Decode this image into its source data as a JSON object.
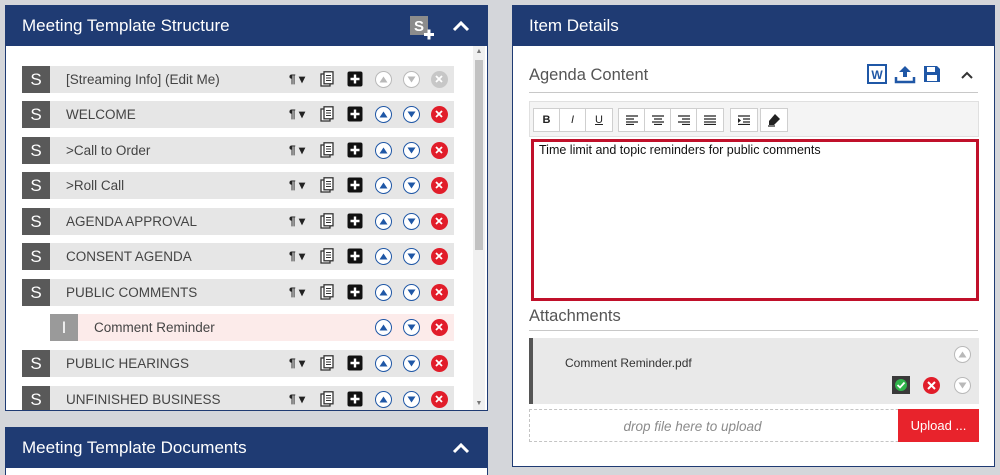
{
  "structure": {
    "title": "Meeting Template Structure",
    "rows": [
      {
        "badge": "S",
        "label": "[Streaming Info] (Edit Me)",
        "kind": "section",
        "first": true
      },
      {
        "badge": "S",
        "label": "WELCOME",
        "kind": "section"
      },
      {
        "badge": "S",
        "label": ">Call to Order",
        "kind": "section"
      },
      {
        "badge": "S",
        "label": ">Roll Call",
        "kind": "section"
      },
      {
        "badge": "S",
        "label": "AGENDA APPROVAL",
        "kind": "section"
      },
      {
        "badge": "S",
        "label": "CONSENT AGENDA",
        "kind": "section"
      },
      {
        "badge": "S",
        "label": "PUBLIC COMMENTS",
        "kind": "section"
      },
      {
        "badge": "I",
        "label": "Comment Reminder",
        "kind": "item"
      },
      {
        "badge": "S",
        "label": "PUBLIC HEARINGS",
        "kind": "section"
      },
      {
        "badge": "S",
        "label": "UNFINISHED BUSINESS",
        "kind": "section"
      }
    ]
  },
  "documents": {
    "title": "Meeting Template Documents"
  },
  "details": {
    "title": "Item Details",
    "agenda_title": "Agenda Content",
    "toolbar": {
      "bold": "B",
      "italic": "I",
      "underline": "U"
    },
    "content": "Time limit and topic reminders for public comments",
    "attachments_title": "Attachments",
    "attachment_file": "Comment Reminder.pdf",
    "drop_text": "drop file here to upload",
    "upload_label": "Upload ..."
  },
  "colors": {
    "header": "#1f3b73",
    "accent_red": "#e11d2a",
    "editor_border": "#c0102a",
    "item_highlight": "#fcebea"
  }
}
